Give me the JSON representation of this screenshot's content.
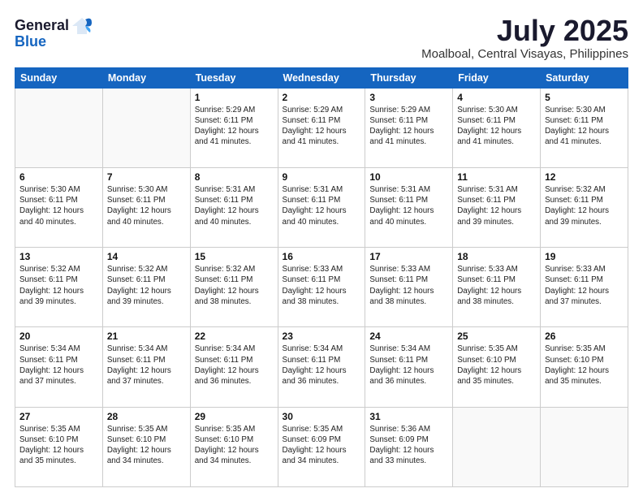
{
  "header": {
    "logo_general": "General",
    "logo_blue": "Blue",
    "month_title": "July 2025",
    "location": "Moalboal, Central Visayas, Philippines"
  },
  "weekdays": [
    "Sunday",
    "Monday",
    "Tuesday",
    "Wednesday",
    "Thursday",
    "Friday",
    "Saturday"
  ],
  "weeks": [
    [
      {
        "day": "",
        "info": ""
      },
      {
        "day": "",
        "info": ""
      },
      {
        "day": "1",
        "info": "Sunrise: 5:29 AM\nSunset: 6:11 PM\nDaylight: 12 hours and 41 minutes."
      },
      {
        "day": "2",
        "info": "Sunrise: 5:29 AM\nSunset: 6:11 PM\nDaylight: 12 hours and 41 minutes."
      },
      {
        "day": "3",
        "info": "Sunrise: 5:29 AM\nSunset: 6:11 PM\nDaylight: 12 hours and 41 minutes."
      },
      {
        "day": "4",
        "info": "Sunrise: 5:30 AM\nSunset: 6:11 PM\nDaylight: 12 hours and 41 minutes."
      },
      {
        "day": "5",
        "info": "Sunrise: 5:30 AM\nSunset: 6:11 PM\nDaylight: 12 hours and 41 minutes."
      }
    ],
    [
      {
        "day": "6",
        "info": "Sunrise: 5:30 AM\nSunset: 6:11 PM\nDaylight: 12 hours and 40 minutes."
      },
      {
        "day": "7",
        "info": "Sunrise: 5:30 AM\nSunset: 6:11 PM\nDaylight: 12 hours and 40 minutes."
      },
      {
        "day": "8",
        "info": "Sunrise: 5:31 AM\nSunset: 6:11 PM\nDaylight: 12 hours and 40 minutes."
      },
      {
        "day": "9",
        "info": "Sunrise: 5:31 AM\nSunset: 6:11 PM\nDaylight: 12 hours and 40 minutes."
      },
      {
        "day": "10",
        "info": "Sunrise: 5:31 AM\nSunset: 6:11 PM\nDaylight: 12 hours and 40 minutes."
      },
      {
        "day": "11",
        "info": "Sunrise: 5:31 AM\nSunset: 6:11 PM\nDaylight: 12 hours and 39 minutes."
      },
      {
        "day": "12",
        "info": "Sunrise: 5:32 AM\nSunset: 6:11 PM\nDaylight: 12 hours and 39 minutes."
      }
    ],
    [
      {
        "day": "13",
        "info": "Sunrise: 5:32 AM\nSunset: 6:11 PM\nDaylight: 12 hours and 39 minutes."
      },
      {
        "day": "14",
        "info": "Sunrise: 5:32 AM\nSunset: 6:11 PM\nDaylight: 12 hours and 39 minutes."
      },
      {
        "day": "15",
        "info": "Sunrise: 5:32 AM\nSunset: 6:11 PM\nDaylight: 12 hours and 38 minutes."
      },
      {
        "day": "16",
        "info": "Sunrise: 5:33 AM\nSunset: 6:11 PM\nDaylight: 12 hours and 38 minutes."
      },
      {
        "day": "17",
        "info": "Sunrise: 5:33 AM\nSunset: 6:11 PM\nDaylight: 12 hours and 38 minutes."
      },
      {
        "day": "18",
        "info": "Sunrise: 5:33 AM\nSunset: 6:11 PM\nDaylight: 12 hours and 38 minutes."
      },
      {
        "day": "19",
        "info": "Sunrise: 5:33 AM\nSunset: 6:11 PM\nDaylight: 12 hours and 37 minutes."
      }
    ],
    [
      {
        "day": "20",
        "info": "Sunrise: 5:34 AM\nSunset: 6:11 PM\nDaylight: 12 hours and 37 minutes."
      },
      {
        "day": "21",
        "info": "Sunrise: 5:34 AM\nSunset: 6:11 PM\nDaylight: 12 hours and 37 minutes."
      },
      {
        "day": "22",
        "info": "Sunrise: 5:34 AM\nSunset: 6:11 PM\nDaylight: 12 hours and 36 minutes."
      },
      {
        "day": "23",
        "info": "Sunrise: 5:34 AM\nSunset: 6:11 PM\nDaylight: 12 hours and 36 minutes."
      },
      {
        "day": "24",
        "info": "Sunrise: 5:34 AM\nSunset: 6:11 PM\nDaylight: 12 hours and 36 minutes."
      },
      {
        "day": "25",
        "info": "Sunrise: 5:35 AM\nSunset: 6:10 PM\nDaylight: 12 hours and 35 minutes."
      },
      {
        "day": "26",
        "info": "Sunrise: 5:35 AM\nSunset: 6:10 PM\nDaylight: 12 hours and 35 minutes."
      }
    ],
    [
      {
        "day": "27",
        "info": "Sunrise: 5:35 AM\nSunset: 6:10 PM\nDaylight: 12 hours and 35 minutes."
      },
      {
        "day": "28",
        "info": "Sunrise: 5:35 AM\nSunset: 6:10 PM\nDaylight: 12 hours and 34 minutes."
      },
      {
        "day": "29",
        "info": "Sunrise: 5:35 AM\nSunset: 6:10 PM\nDaylight: 12 hours and 34 minutes."
      },
      {
        "day": "30",
        "info": "Sunrise: 5:35 AM\nSunset: 6:09 PM\nDaylight: 12 hours and 34 minutes."
      },
      {
        "day": "31",
        "info": "Sunrise: 5:36 AM\nSunset: 6:09 PM\nDaylight: 12 hours and 33 minutes."
      },
      {
        "day": "",
        "info": ""
      },
      {
        "day": "",
        "info": ""
      }
    ]
  ]
}
